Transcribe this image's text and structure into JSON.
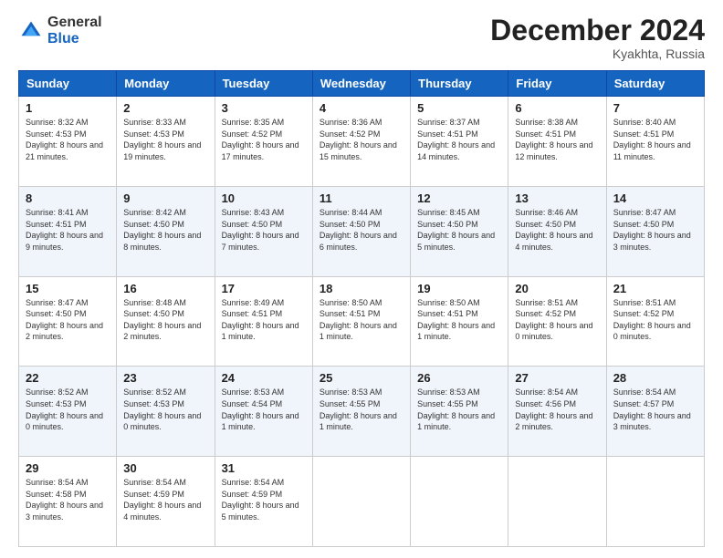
{
  "header": {
    "logo_general": "General",
    "logo_blue": "Blue",
    "month": "December 2024",
    "location": "Kyakhta, Russia"
  },
  "days_of_week": [
    "Sunday",
    "Monday",
    "Tuesday",
    "Wednesday",
    "Thursday",
    "Friday",
    "Saturday"
  ],
  "weeks": [
    [
      {
        "day": 1,
        "sunrise": "8:32 AM",
        "sunset": "4:53 PM",
        "daylight": "8 hours and 21 minutes."
      },
      {
        "day": 2,
        "sunrise": "8:33 AM",
        "sunset": "4:53 PM",
        "daylight": "8 hours and 19 minutes."
      },
      {
        "day": 3,
        "sunrise": "8:35 AM",
        "sunset": "4:52 PM",
        "daylight": "8 hours and 17 minutes."
      },
      {
        "day": 4,
        "sunrise": "8:36 AM",
        "sunset": "4:52 PM",
        "daylight": "8 hours and 15 minutes."
      },
      {
        "day": 5,
        "sunrise": "8:37 AM",
        "sunset": "4:51 PM",
        "daylight": "8 hours and 14 minutes."
      },
      {
        "day": 6,
        "sunrise": "8:38 AM",
        "sunset": "4:51 PM",
        "daylight": "8 hours and 12 minutes."
      },
      {
        "day": 7,
        "sunrise": "8:40 AM",
        "sunset": "4:51 PM",
        "daylight": "8 hours and 11 minutes."
      }
    ],
    [
      {
        "day": 8,
        "sunrise": "8:41 AM",
        "sunset": "4:51 PM",
        "daylight": "8 hours and 9 minutes."
      },
      {
        "day": 9,
        "sunrise": "8:42 AM",
        "sunset": "4:50 PM",
        "daylight": "8 hours and 8 minutes."
      },
      {
        "day": 10,
        "sunrise": "8:43 AM",
        "sunset": "4:50 PM",
        "daylight": "8 hours and 7 minutes."
      },
      {
        "day": 11,
        "sunrise": "8:44 AM",
        "sunset": "4:50 PM",
        "daylight": "8 hours and 6 minutes."
      },
      {
        "day": 12,
        "sunrise": "8:45 AM",
        "sunset": "4:50 PM",
        "daylight": "8 hours and 5 minutes."
      },
      {
        "day": 13,
        "sunrise": "8:46 AM",
        "sunset": "4:50 PM",
        "daylight": "8 hours and 4 minutes."
      },
      {
        "day": 14,
        "sunrise": "8:47 AM",
        "sunset": "4:50 PM",
        "daylight": "8 hours and 3 minutes."
      }
    ],
    [
      {
        "day": 15,
        "sunrise": "8:47 AM",
        "sunset": "4:50 PM",
        "daylight": "8 hours and 2 minutes."
      },
      {
        "day": 16,
        "sunrise": "8:48 AM",
        "sunset": "4:50 PM",
        "daylight": "8 hours and 2 minutes."
      },
      {
        "day": 17,
        "sunrise": "8:49 AM",
        "sunset": "4:51 PM",
        "daylight": "8 hours and 1 minute."
      },
      {
        "day": 18,
        "sunrise": "8:50 AM",
        "sunset": "4:51 PM",
        "daylight": "8 hours and 1 minute."
      },
      {
        "day": 19,
        "sunrise": "8:50 AM",
        "sunset": "4:51 PM",
        "daylight": "8 hours and 1 minute."
      },
      {
        "day": 20,
        "sunrise": "8:51 AM",
        "sunset": "4:52 PM",
        "daylight": "8 hours and 0 minutes."
      },
      {
        "day": 21,
        "sunrise": "8:51 AM",
        "sunset": "4:52 PM",
        "daylight": "8 hours and 0 minutes."
      }
    ],
    [
      {
        "day": 22,
        "sunrise": "8:52 AM",
        "sunset": "4:53 PM",
        "daylight": "8 hours and 0 minutes."
      },
      {
        "day": 23,
        "sunrise": "8:52 AM",
        "sunset": "4:53 PM",
        "daylight": "8 hours and 0 minutes."
      },
      {
        "day": 24,
        "sunrise": "8:53 AM",
        "sunset": "4:54 PM",
        "daylight": "8 hours and 1 minute."
      },
      {
        "day": 25,
        "sunrise": "8:53 AM",
        "sunset": "4:55 PM",
        "daylight": "8 hours and 1 minute."
      },
      {
        "day": 26,
        "sunrise": "8:53 AM",
        "sunset": "4:55 PM",
        "daylight": "8 hours and 1 minute."
      },
      {
        "day": 27,
        "sunrise": "8:54 AM",
        "sunset": "4:56 PM",
        "daylight": "8 hours and 2 minutes."
      },
      {
        "day": 28,
        "sunrise": "8:54 AM",
        "sunset": "4:57 PM",
        "daylight": "8 hours and 3 minutes."
      }
    ],
    [
      {
        "day": 29,
        "sunrise": "8:54 AM",
        "sunset": "4:58 PM",
        "daylight": "8 hours and 3 minutes."
      },
      {
        "day": 30,
        "sunrise": "8:54 AM",
        "sunset": "4:59 PM",
        "daylight": "8 hours and 4 minutes."
      },
      {
        "day": 31,
        "sunrise": "8:54 AM",
        "sunset": "4:59 PM",
        "daylight": "8 hours and 5 minutes."
      },
      null,
      null,
      null,
      null
    ]
  ]
}
